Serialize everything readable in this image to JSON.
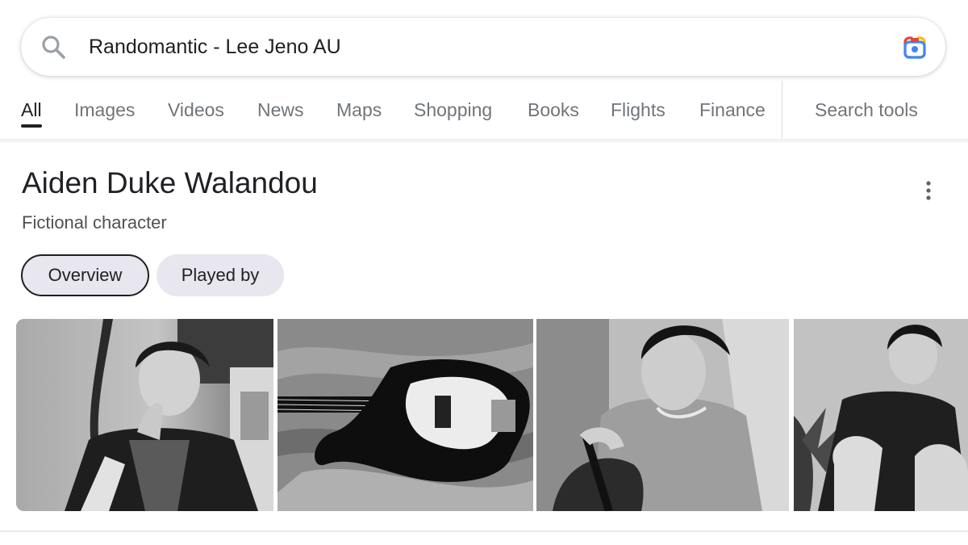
{
  "search": {
    "query": "Randomantic - Lee Jeno AU",
    "search_icon": "search-icon",
    "lens_icon": "google-lens-icon"
  },
  "tabs": [
    {
      "label": "All",
      "active": true
    },
    {
      "label": "Images"
    },
    {
      "label": "Videos"
    },
    {
      "label": "News"
    },
    {
      "label": "Maps"
    },
    {
      "label": "Shopping"
    },
    {
      "label": "Books"
    },
    {
      "label": "Flights"
    },
    {
      "label": "Finance"
    },
    {
      "label": "Search tools"
    }
  ],
  "entity": {
    "title": "Aiden Duke Walandou",
    "subtitle": "Fictional character",
    "more_icon": "more-vertical-icon",
    "chips": [
      {
        "label": "Overview",
        "selected": true
      },
      {
        "label": "Played by"
      }
    ]
  },
  "images": [
    {
      "subject": "man-hand-on-chin-photo"
    },
    {
      "subject": "bass-guitar-on-bed-photo"
    },
    {
      "subject": "man-playing-bass-photo"
    },
    {
      "subject": "man-crouching-photo"
    }
  ],
  "colors": {
    "lens_blue": "#4285f4",
    "lens_red": "#ea4335",
    "lens_yellow": "#fbbc04",
    "lens_green": "#34a853",
    "chip_bg": "#e8e6ee"
  }
}
